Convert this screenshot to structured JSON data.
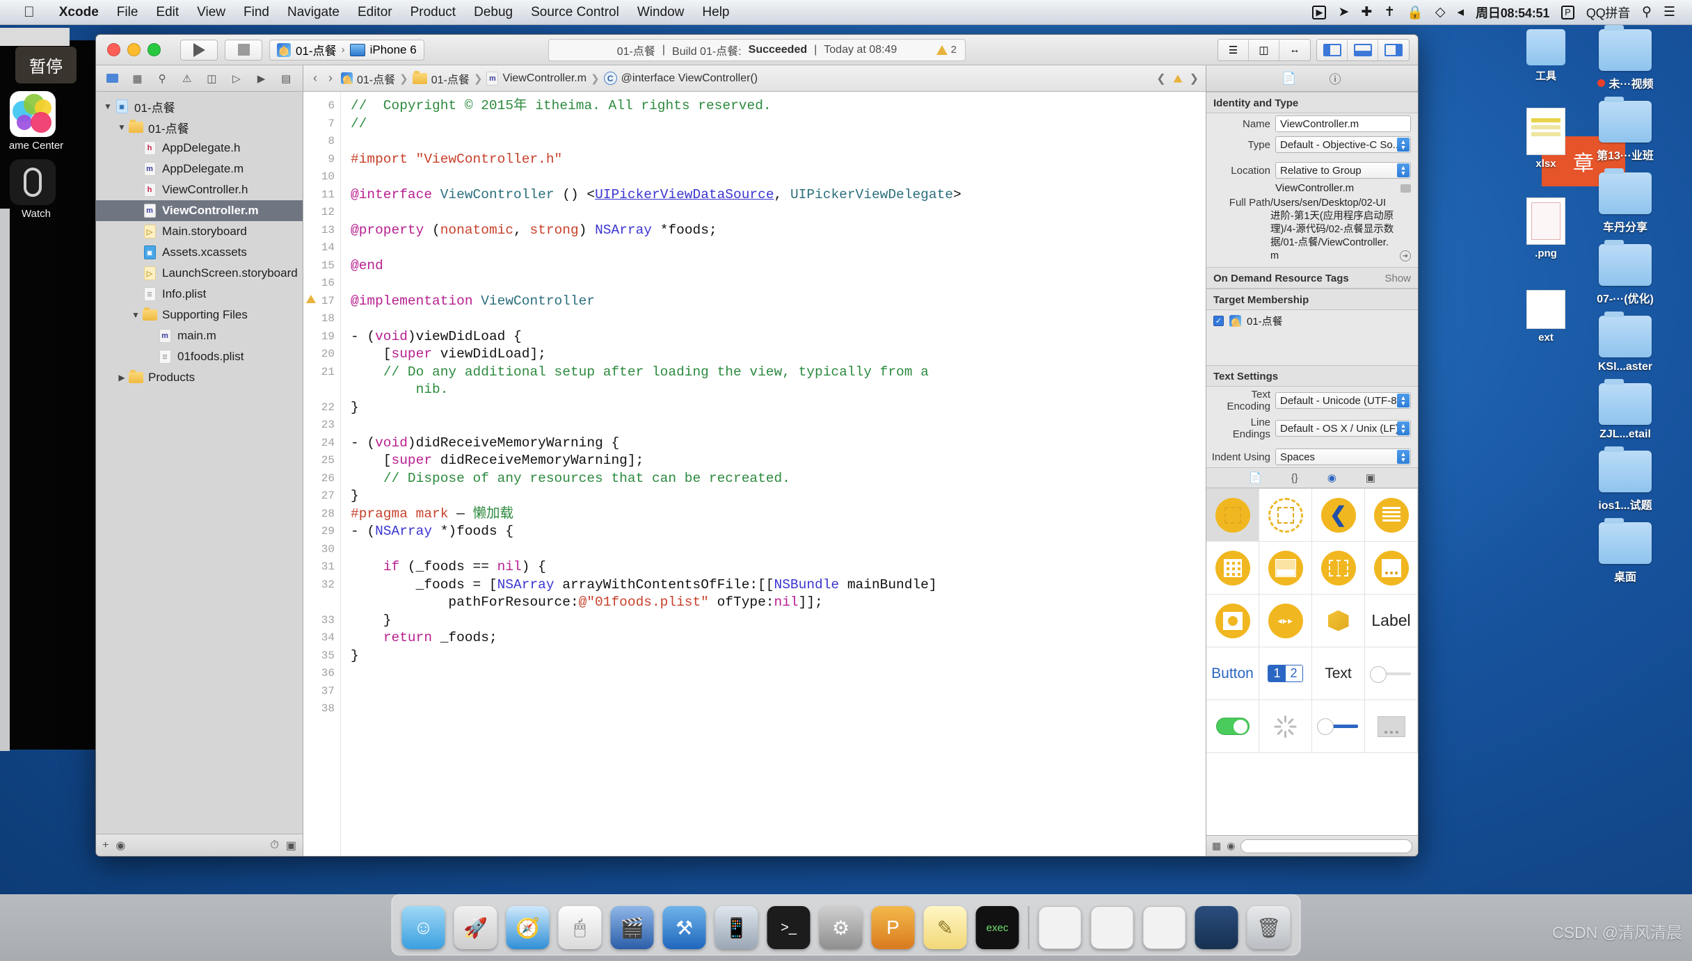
{
  "menubar": {
    "apple_icon": "apple-icon",
    "items": [
      "Xcode",
      "File",
      "Edit",
      "View",
      "Find",
      "Navigate",
      "Editor",
      "Product",
      "Debug",
      "Source Control",
      "Window",
      "Help"
    ],
    "status_icons": [
      "screen-record-icon",
      "location-icon",
      "airplay-icon",
      "bluetooth-icon",
      "lock-icon",
      "wifi-icon",
      "volume-icon"
    ],
    "time": "周日08:54:51",
    "input_badge": "P",
    "input_method": "QQ拼音",
    "search_icon": "search-icon",
    "list_icon": "notification-list-icon"
  },
  "simulator_overlay": {
    "tooltip": "暂停",
    "game_center_label": "ame Center",
    "watch_label": "Watch"
  },
  "xcode": {
    "toolbar": {
      "run_icon": "run-play-icon",
      "stop_icon": "stop-square-icon",
      "scheme_name": "01-点餐",
      "destination": "iPhone 6",
      "status": {
        "project": "01-点餐",
        "separator": "|",
        "build_text": "Build 01-点餐:",
        "result": "Succeeded",
        "time": "Today at 08:49"
      },
      "warning_count": "2",
      "editor_segment": [
        "standard-editor-icon",
        "assistant-editor-icon",
        "version-editor-icon"
      ],
      "view_segment": [
        "navigator-toggle-icon",
        "debug-area-toggle-icon",
        "utilities-toggle-icon"
      ]
    },
    "navigator": {
      "tabs": [
        "project-navigator-icon",
        "symbol-navigator-icon",
        "search-navigator-icon",
        "issue-navigator-icon",
        "test-navigator-icon",
        "debug-navigator-icon",
        "breakpoint-navigator-icon",
        "report-navigator-icon"
      ],
      "tree": [
        {
          "label": "01-点餐",
          "indent": 0,
          "twisty": "▼",
          "icon": "xcode-project-icon",
          "selected": false
        },
        {
          "label": "01-点餐",
          "indent": 1,
          "twisty": "▼",
          "icon": "folder-icon",
          "selected": false
        },
        {
          "label": "AppDelegate.h",
          "indent": 2,
          "twisty": "",
          "icon": "header-file-icon",
          "selected": false
        },
        {
          "label": "AppDelegate.m",
          "indent": 2,
          "twisty": "",
          "icon": "objc-file-icon",
          "selected": false
        },
        {
          "label": "ViewController.h",
          "indent": 2,
          "twisty": "",
          "icon": "header-file-icon",
          "selected": false
        },
        {
          "label": "ViewController.m",
          "indent": 2,
          "twisty": "",
          "icon": "objc-file-icon",
          "selected": true
        },
        {
          "label": "Main.storyboard",
          "indent": 2,
          "twisty": "",
          "icon": "storyboard-file-icon",
          "selected": false
        },
        {
          "label": "Assets.xcassets",
          "indent": 2,
          "twisty": "",
          "icon": "xcassets-icon",
          "selected": false
        },
        {
          "label": "LaunchScreen.storyboard",
          "indent": 2,
          "twisty": "",
          "icon": "storyboard-file-icon",
          "selected": false
        },
        {
          "label": "Info.plist",
          "indent": 2,
          "twisty": "",
          "icon": "plist-file-icon",
          "selected": false
        },
        {
          "label": "Supporting Files",
          "indent": 2,
          "twisty": "▼",
          "icon": "folder-icon",
          "selected": false
        },
        {
          "label": "main.m",
          "indent": 3,
          "twisty": "",
          "icon": "objc-file-icon",
          "selected": false
        },
        {
          "label": "01foods.plist",
          "indent": 3,
          "twisty": "",
          "icon": "plist-file-icon",
          "selected": false
        },
        {
          "label": "Products",
          "indent": 1,
          "twisty": "▶",
          "icon": "folder-icon",
          "selected": false
        }
      ],
      "footer": {
        "add_icon": "plus-icon",
        "filter_icon": "filter-icon"
      }
    },
    "jumpbar": {
      "back_icon": "chevron-left-icon",
      "forward_icon": "chevron-right-icon",
      "crumbs": [
        "01-点餐",
        "01-点餐",
        "ViewController.m",
        "@interface ViewController()"
      ],
      "right_icons": [
        "related-items-icon",
        "warning-icon",
        "next-issue-icon"
      ]
    },
    "code": {
      "first_line_number": 6,
      "lines": [
        {
          "n": 6,
          "warn": false,
          "html": "<span class='c-cm'>//  Copyright © 2015年 itheima. All rights reserved.</span>"
        },
        {
          "n": 7,
          "warn": false,
          "html": "<span class='c-cm'>//</span>"
        },
        {
          "n": 8,
          "warn": false,
          "html": ""
        },
        {
          "n": 9,
          "warn": false,
          "html": "<span class='c-pp'>#import \"ViewController.h\"</span>"
        },
        {
          "n": 10,
          "warn": false,
          "html": ""
        },
        {
          "n": 11,
          "warn": false,
          "html": "<span class='c-kw'>@interface</span> <span class='c-cls'>ViewController</span> () &lt;<span class='c-proto'>UIPickerViewDataSource</span>, <span class='c-cls'>UIPickerViewDelegate</span>&gt;"
        },
        {
          "n": 12,
          "warn": false,
          "html": ""
        },
        {
          "n": 13,
          "warn": false,
          "html": "<span class='c-kw'>@property</span> (<span class='c-pp'>nonatomic</span>, <span class='c-pp'>strong</span>) <span class='c-ty'>NSArray</span> *foods;"
        },
        {
          "n": 14,
          "warn": false,
          "html": ""
        },
        {
          "n": 15,
          "warn": false,
          "html": "<span class='c-kw'>@end</span>"
        },
        {
          "n": 16,
          "warn": false,
          "html": ""
        },
        {
          "n": 17,
          "warn": true,
          "html": "<span class='c-kw'>@implementation</span> <span class='c-cls'>ViewController</span>"
        },
        {
          "n": 18,
          "warn": false,
          "html": ""
        },
        {
          "n": 19,
          "warn": false,
          "html": "- (<span class='c-kw'>void</span>)viewDidLoad {"
        },
        {
          "n": 20,
          "warn": false,
          "html": "    [<span class='c-kw'>super</span> viewDidLoad];"
        },
        {
          "n": 21,
          "warn": false,
          "html": "    <span class='c-cm'>// Do any additional setup after loading the view, typically from a</span>"
        },
        {
          "n": "",
          "warn": false,
          "html": "        <span class='c-cm'>nib.</span>"
        },
        {
          "n": 22,
          "warn": false,
          "html": "}"
        },
        {
          "n": 23,
          "warn": false,
          "html": ""
        },
        {
          "n": 24,
          "warn": false,
          "html": "- (<span class='c-kw'>void</span>)didReceiveMemoryWarning {"
        },
        {
          "n": 25,
          "warn": false,
          "html": "    [<span class='c-kw'>super</span> didReceiveMemoryWarning];"
        },
        {
          "n": 26,
          "warn": false,
          "html": "    <span class='c-cm'>// Dispose of any resources that can be recreated.</span>"
        },
        {
          "n": 27,
          "warn": false,
          "html": "}"
        },
        {
          "n": 28,
          "warn": false,
          "html": "<span class='c-pp'>#pragma mark</span> — <span class='c-cm'>懒加载</span>"
        },
        {
          "n": 29,
          "warn": false,
          "html": "- (<span class='c-ty'>NSArray</span> *)foods {"
        },
        {
          "n": 30,
          "warn": false,
          "html": ""
        },
        {
          "n": 31,
          "warn": false,
          "html": "    <span class='c-kw'>if</span> (_foods == <span class='c-kw'>nil</span>) {"
        },
        {
          "n": 32,
          "warn": false,
          "html": "        _foods = [<span class='c-ty'>NSArray</span> arrayWithContentsOfFile:[[<span class='c-ty'>NSBundle</span> mainBundle]"
        },
        {
          "n": "",
          "warn": false,
          "html": "            pathForResource:<span class='c-str'>@\"01foods.plist\"</span> ofType:<span class='c-kw'>nil</span>]];"
        },
        {
          "n": 33,
          "warn": false,
          "html": "    }"
        },
        {
          "n": 34,
          "warn": false,
          "html": "    <span class='c-kw'>return</span> _foods;"
        },
        {
          "n": 35,
          "warn": false,
          "html": "}"
        },
        {
          "n": 36,
          "warn": false,
          "html": ""
        },
        {
          "n": 37,
          "warn": false,
          "html": ""
        },
        {
          "n": 38,
          "warn": false,
          "html": ""
        }
      ]
    },
    "inspector": {
      "tabs": [
        "file-inspector-icon",
        "quick-help-icon"
      ],
      "identity_and_type": {
        "header": "Identity and Type",
        "name_label": "Name",
        "name_value": "ViewController.m",
        "type_label": "Type",
        "type_value": "Default - Objective-C So...",
        "location_label": "Location",
        "location_value": "Relative to Group",
        "location_file": "ViewController.m",
        "full_path_label": "Full Path",
        "full_path_value": "/Users/sen/Desktop/02-UI进阶-第1天(应用程序启动原理)/4-源代码/02-点餐显示数据/01-点餐/ViewController.m"
      },
      "on_demand": {
        "header": "On Demand Resource Tags",
        "show": "Show"
      },
      "target_membership": {
        "header": "Target Membership",
        "target": "01-点餐",
        "checked": true
      },
      "text_settings": {
        "header": "Text Settings",
        "encoding_label": "Text Encoding",
        "encoding_value": "Default - Unicode (UTF-8)",
        "line_endings_label": "Line Endings",
        "line_endings_value": "Default - OS X / Unix (LF)",
        "indent_label": "Indent Using",
        "indent_value": "Spaces"
      },
      "library_tabs": [
        "file-template-library-icon",
        "code-snippet-library-icon",
        "object-library-icon",
        "media-library-icon"
      ],
      "library_items": [
        {
          "name": "view-object",
          "kind": "circle-solid-square",
          "selected": true
        },
        {
          "name": "container-view-object",
          "kind": "circle-dashed",
          "selected": false
        },
        {
          "name": "navigation-back-object",
          "kind": "chevron",
          "selected": false
        },
        {
          "name": "table-view-object",
          "kind": "lines",
          "selected": false
        },
        {
          "name": "collection-view-object",
          "kind": "grid",
          "selected": false
        },
        {
          "name": "table-view-cell-object",
          "kind": "cell",
          "selected": false
        },
        {
          "name": "split-view-object",
          "kind": "split",
          "selected": false
        },
        {
          "name": "page-view-object",
          "kind": "page",
          "selected": false
        },
        {
          "name": "image-view-object",
          "kind": "image",
          "selected": false
        },
        {
          "name": "player-view-object",
          "kind": "player",
          "selected": false
        },
        {
          "name": "object-cube",
          "kind": "cube",
          "selected": false
        },
        {
          "name": "label-object",
          "kind": "text",
          "label": "Label",
          "selected": false
        },
        {
          "name": "button-object",
          "kind": "text",
          "label": "Button",
          "selected": false
        },
        {
          "name": "segmented-control-object",
          "kind": "seg",
          "labels": [
            "1",
            "2"
          ],
          "selected": false
        },
        {
          "name": "text-field-object",
          "kind": "text",
          "label": "Text",
          "selected": false
        },
        {
          "name": "slider-object",
          "kind": "slider",
          "selected": false
        },
        {
          "name": "switch-object",
          "kind": "switch",
          "selected": false
        },
        {
          "name": "activity-indicator-object",
          "kind": "spinner",
          "selected": false
        },
        {
          "name": "progress-view-object",
          "kind": "progress",
          "selected": false
        },
        {
          "name": "page-control-object",
          "kind": "pagectl",
          "selected": false
        }
      ],
      "footer": {
        "grid_icon": "grid-view-icon",
        "filter_icon": "filter-icon"
      }
    }
  },
  "desktop": {
    "folders_right": [
      {
        "label": "未···视频",
        "badge": true
      },
      {
        "label": "第13···业班",
        "badge": false
      },
      {
        "label": "车丹分享",
        "badge": false
      },
      {
        "label": "07-···(优化)",
        "badge": false
      },
      {
        "label": "KSI...aster",
        "badge": false
      },
      {
        "label": "ZJL...etail",
        "badge": false
      },
      {
        "label": "ios1...试题",
        "badge": false
      },
      {
        "label": "桌面",
        "badge": false
      }
    ],
    "files_col2": [
      {
        "label": "工具",
        "kind": "folder"
      },
      {
        "label": "xlsx",
        "kind": "spreadsheet"
      },
      {
        "label": ".png",
        "kind": "image"
      },
      {
        "label": "ext",
        "kind": "text"
      }
    ],
    "orange_banner": "章"
  },
  "dock": {
    "items": [
      "finder-icon",
      "launchpad-icon",
      "safari-icon",
      "mouse-icon",
      "quicktime-icon",
      "xcode-icon",
      "simulator-icon",
      "terminal-icon",
      "settings-icon",
      "keynote-icon",
      "notes-icon",
      "console-icon",
      "separator",
      "window1-icon",
      "window2-icon",
      "window3-icon",
      "window4-icon",
      "trash-icon"
    ]
  },
  "watermark": "CSDN @清风清晨"
}
